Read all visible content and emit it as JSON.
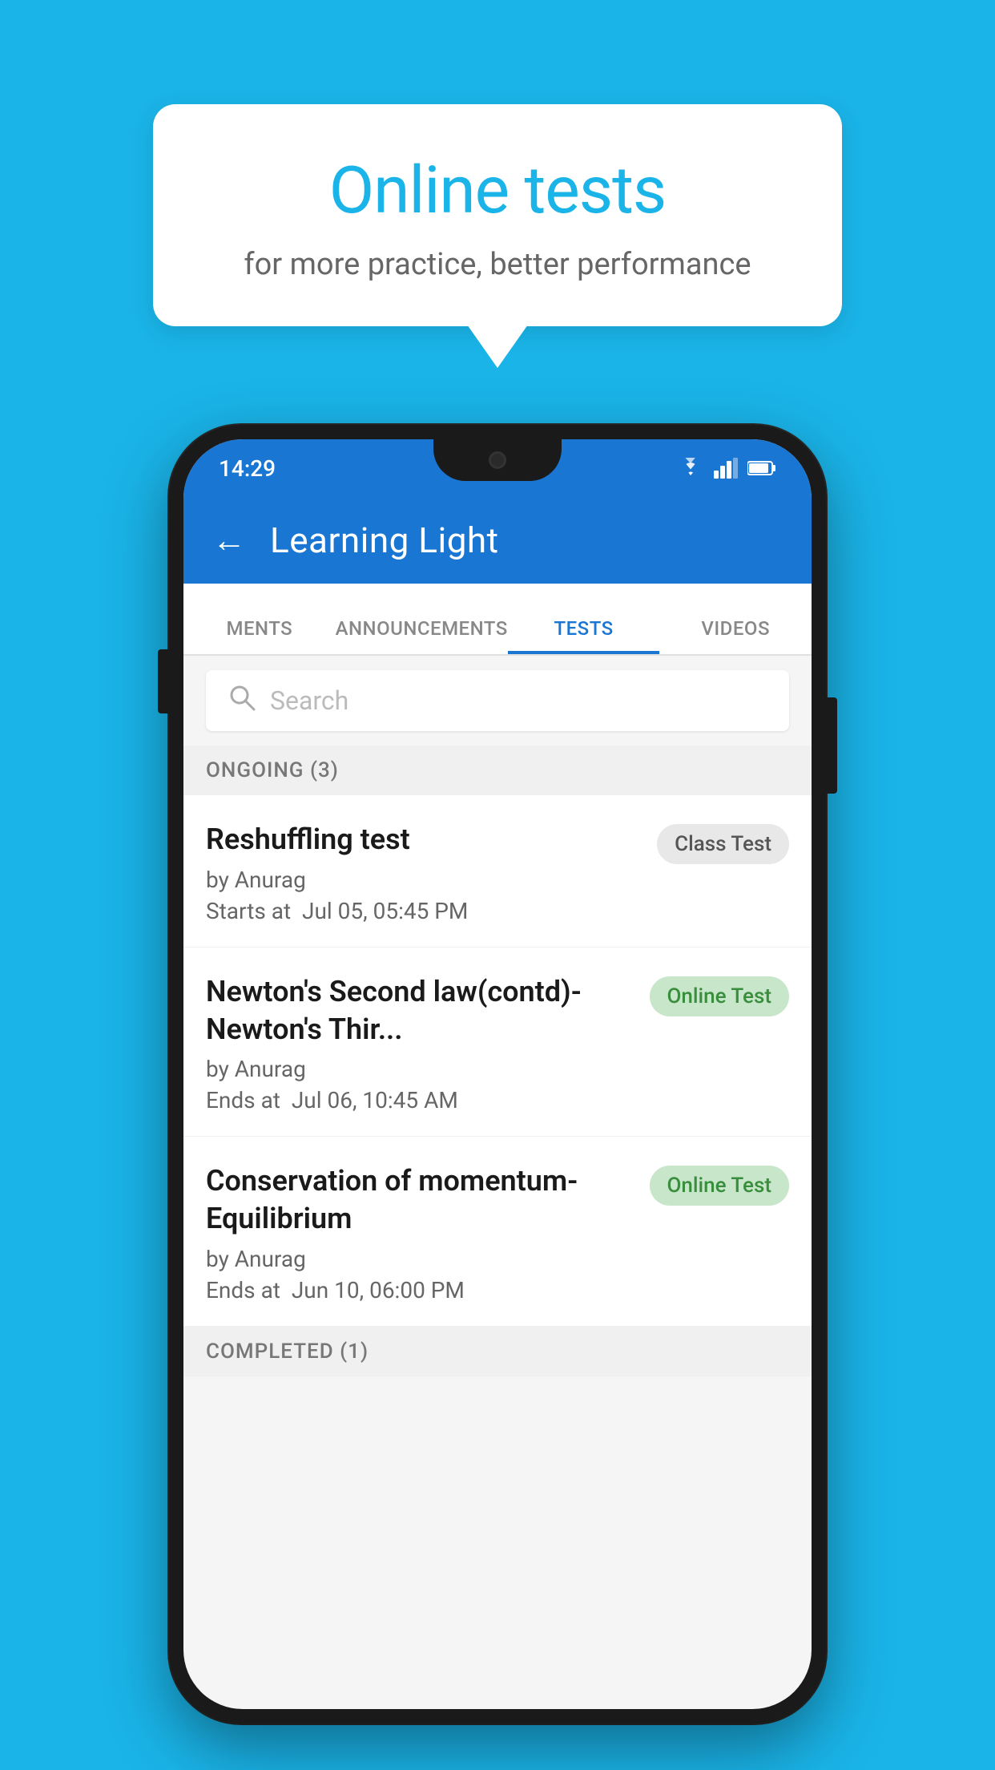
{
  "background": {
    "color": "#1ab4e8"
  },
  "speech_bubble": {
    "title": "Online tests",
    "subtitle": "for more practice, better performance"
  },
  "phone": {
    "status_bar": {
      "time": "14:29",
      "icons": [
        "wifi",
        "signal",
        "battery"
      ]
    },
    "app_header": {
      "back_label": "←",
      "title": "Learning Light"
    },
    "tabs": [
      {
        "label": "MENTS",
        "active": false
      },
      {
        "label": "ANNOUNCEMENTS",
        "active": false
      },
      {
        "label": "TESTS",
        "active": true
      },
      {
        "label": "VIDEOS",
        "active": false
      }
    ],
    "search": {
      "placeholder": "Search"
    },
    "sections": [
      {
        "header": "ONGOING (3)",
        "tests": [
          {
            "name": "Reshuffling test",
            "by": "by Anurag",
            "date_label": "Starts at",
            "date": "Jul 05, 05:45 PM",
            "badge": "Class Test",
            "badge_type": "class"
          },
          {
            "name": "Newton's Second law(contd)-Newton's Thir...",
            "by": "by Anurag",
            "date_label": "Ends at",
            "date": "Jul 06, 10:45 AM",
            "badge": "Online Test",
            "badge_type": "online"
          },
          {
            "name": "Conservation of momentum-Equilibrium",
            "by": "by Anurag",
            "date_label": "Ends at",
            "date": "Jun 10, 06:00 PM",
            "badge": "Online Test",
            "badge_type": "online"
          }
        ]
      },
      {
        "header": "COMPLETED (1)",
        "tests": []
      }
    ]
  }
}
